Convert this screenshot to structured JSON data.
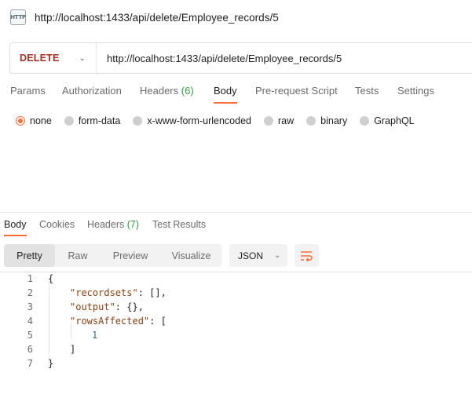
{
  "request": {
    "icon_text": "HTTP",
    "title": "http://localhost:1433/api/delete/Employee_records/5",
    "method": "DELETE",
    "url": "http://localhost:1433/api/delete/Employee_records/5"
  },
  "request_tabs": {
    "params": "Params",
    "authorization": "Authorization",
    "headers": "Headers",
    "headers_count": "(6)",
    "body": "Body",
    "prerequest": "Pre-request Script",
    "tests": "Tests",
    "settings": "Settings"
  },
  "body_types": {
    "none": "none",
    "form_data": "form-data",
    "urlencoded": "x-www-form-urlencoded",
    "raw": "raw",
    "binary": "binary",
    "graphql": "GraphQL",
    "selected": "none"
  },
  "response_tabs": {
    "body": "Body",
    "cookies": "Cookies",
    "headers": "Headers",
    "headers_count": "(7)",
    "test_results": "Test Results"
  },
  "view_modes": {
    "pretty": "Pretty",
    "raw": "Raw",
    "preview": "Preview",
    "visualize": "Visualize",
    "selected": "Pretty"
  },
  "format": "JSON",
  "code": {
    "line_numbers": [
      "1",
      "2",
      "3",
      "4",
      "5",
      "6",
      "7"
    ],
    "l1": "{",
    "l2_key": "\"recordsets\"",
    "l2_rest": ": [],",
    "l3_key": "\"output\"",
    "l3_rest": ": {},",
    "l4_key": "\"rowsAffected\"",
    "l4_rest": ": [",
    "l5_val": "1",
    "l6": "]",
    "l7": "}"
  },
  "colors": {
    "accent": "#ff6c37",
    "method": "#a5301f",
    "count": "#2f9e44"
  }
}
